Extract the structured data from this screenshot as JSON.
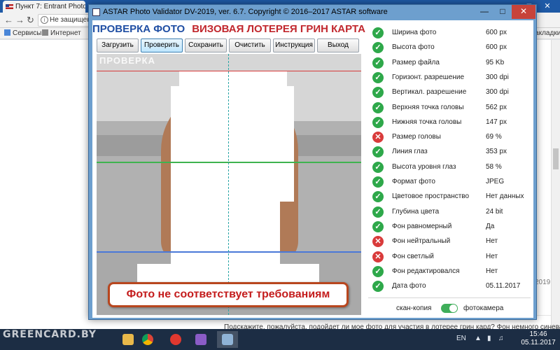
{
  "browser": {
    "tab_title": "Пункт 7: Entrant Photogr",
    "address": "Не защищен",
    "bookmarks": [
      {
        "label": "Сервисы",
        "color": "#4a86d8"
      },
      {
        "label": "Интернет",
        "color": "#777777"
      }
    ],
    "bookmarks_right": "Закладки",
    "forum_text": "Подскажите, пожалуйста, подойдет ли мое фото для участия в лотерее грин кард? Фон немного синеватый и",
    "side_date": "2019"
  },
  "taskbar": {
    "watermark": "GREENCARD.BY",
    "language": "EN",
    "clock_time": "15:46",
    "clock_date": "05.11.2017",
    "apps": [
      {
        "name": "explorer",
        "color": "#e8b84a"
      },
      {
        "name": "chrome",
        "color": "#4caf50"
      },
      {
        "name": "opera",
        "color": "#e0382f"
      },
      {
        "name": "visual-studio",
        "color": "#8a5cc7"
      },
      {
        "name": "photo-validator",
        "color": "#8fb3d6"
      }
    ]
  },
  "window": {
    "title": "ASTAR Photo Validator DV-2019, ver. 6.7.  Copyright © 2016–2017 ASTAR software"
  },
  "header": {
    "left": "ПРОВЕРКА ФОТО",
    "right": "ВИЗОВАЯ ЛОТЕРЕЯ ГРИН КАРТА"
  },
  "toolbar": {
    "load": "Загрузить",
    "check": "Проверить",
    "save": "Сохранить",
    "clear": "Очистить",
    "help": "Инструкция",
    "exit": "Выход"
  },
  "photo": {
    "stamp": "ПРОВЕРКА",
    "verdict": "Фото не соответствует требованиям"
  },
  "results": [
    {
      "label": "Ширина фото",
      "value": "600 px",
      "status": "ok"
    },
    {
      "label": "Высота фото",
      "value": "600 px",
      "status": "ok"
    },
    {
      "label": "Размер файла",
      "value": "95 Kb",
      "status": "ok"
    },
    {
      "label": "Горизонт. разрешение",
      "value": "300 dpi",
      "status": "ok"
    },
    {
      "label": "Вертикал. разрешение",
      "value": "300 dpi",
      "status": "ok"
    },
    {
      "label": "Верхняя точка головы",
      "value": "562 px",
      "status": "ok"
    },
    {
      "label": "Нижняя точка головы",
      "value": "147 px",
      "status": "ok"
    },
    {
      "label": "Размер головы",
      "value": "69 %",
      "status": "bad"
    },
    {
      "label": "Линия глаз",
      "value": "353 px",
      "status": "ok"
    },
    {
      "label": "Высота уровня глаз",
      "value": "58 %",
      "status": "ok"
    },
    {
      "label": "Формат фото",
      "value": "JPEG",
      "status": "ok"
    },
    {
      "label": "Цветовое пространство",
      "value": "Нет данных",
      "status": "ok"
    },
    {
      "label": "Глубина цвета",
      "value": "24 bit",
      "status": "ok"
    },
    {
      "label": "Фон равномерный",
      "value": "Да",
      "status": "ok"
    },
    {
      "label": "Фон нейтральный",
      "value": "Нет",
      "status": "bad"
    },
    {
      "label": "Фон светлый",
      "value": "Нет",
      "status": "bad"
    },
    {
      "label": "Фон редактировался",
      "value": "Нет",
      "status": "ok"
    },
    {
      "label": "Дата фото",
      "value": "05.11.2017",
      "status": "ok"
    }
  ],
  "mode": {
    "left_label": "скан-копия",
    "right_label": "фотокамера",
    "camera_selected": true
  }
}
